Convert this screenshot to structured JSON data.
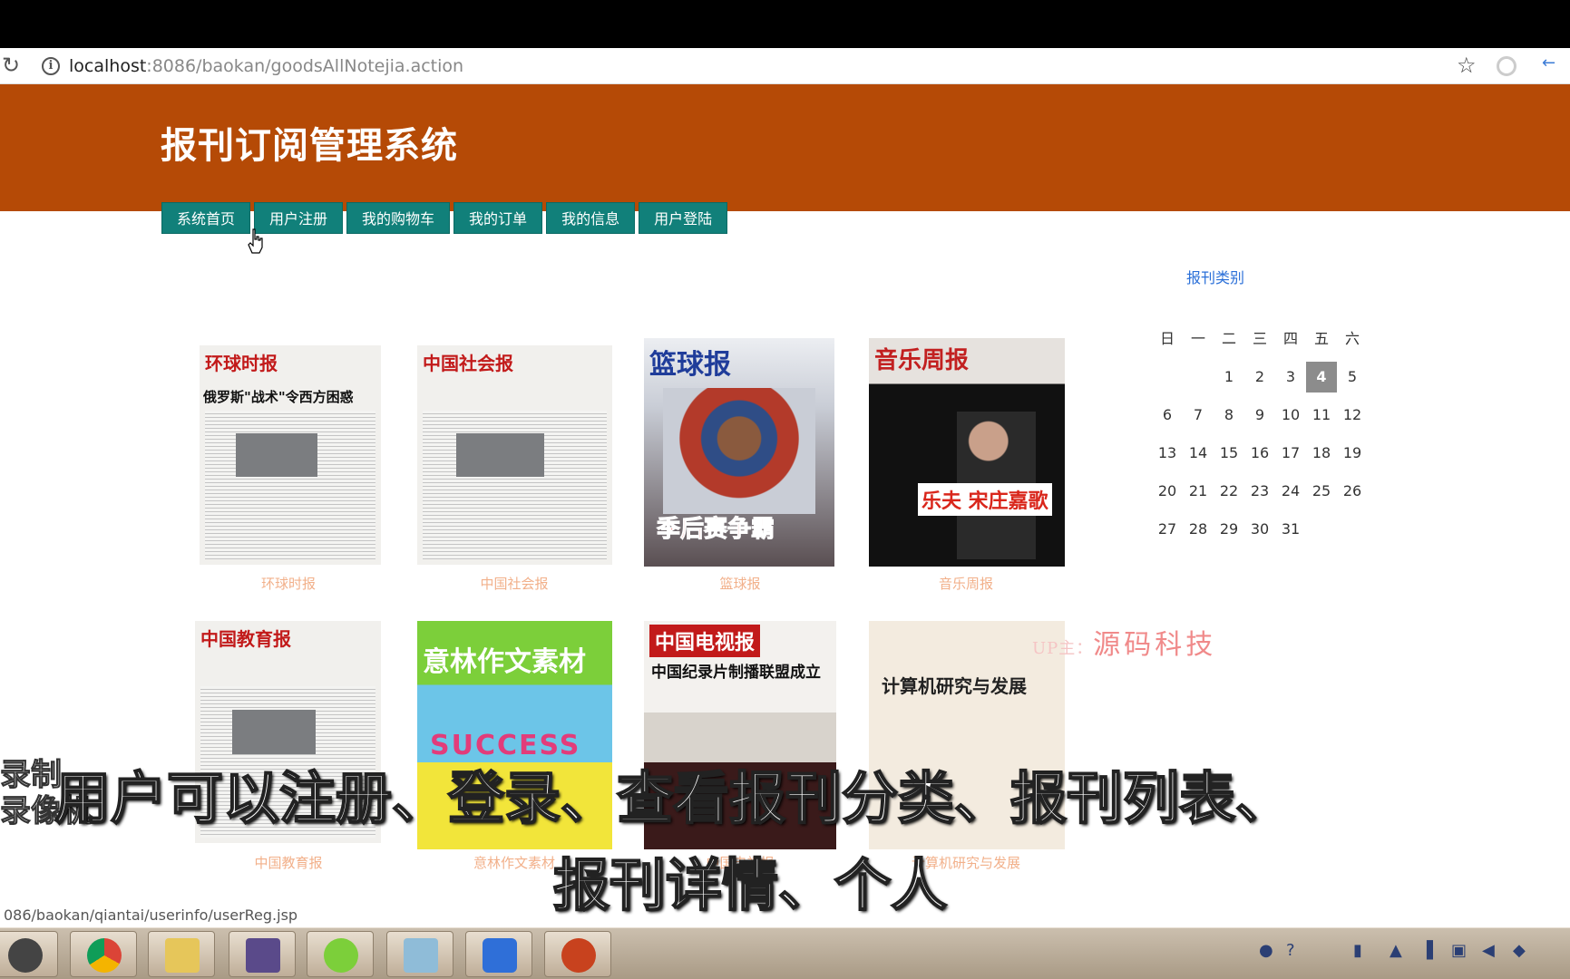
{
  "browser": {
    "url_host": "localhost",
    "url_rest": ":8086/baokan/goodsAllNotejia.action"
  },
  "site": {
    "title": "报刊订阅管理系统"
  },
  "nav": [
    "系统首页",
    "用户注册",
    "我的购物车",
    "我的订单",
    "我的信息",
    "用户登陆"
  ],
  "sidebar": {
    "category_link": "报刊类别"
  },
  "papers": [
    {
      "name": "环球时报",
      "masthead": "环球时报",
      "headline": "俄罗斯\"战术\"令西方困惑",
      "theme": "news"
    },
    {
      "name": "中国社会报",
      "masthead": "中国社会报",
      "headline": "",
      "theme": "news"
    },
    {
      "name": "篮球报",
      "masthead": "篮球报",
      "headline": "季后赛争霸",
      "theme": "sports"
    },
    {
      "name": "音乐周报",
      "masthead": "音乐周报",
      "headline": "乐夫 宋庄嘉歌",
      "theme": "music"
    },
    {
      "name": "中国教育报",
      "masthead": "中国教育报",
      "headline": "",
      "theme": "news"
    },
    {
      "name": "意林作文素材",
      "masthead": "意林作文素材",
      "headline": "SUCCESS",
      "theme": "green"
    },
    {
      "name": "中国电视报",
      "masthead": "中国电视报",
      "headline": "中国纪录片制播联盟成立",
      "theme": "tv"
    },
    {
      "name": "计算机研究与发展",
      "masthead": "计算机研究与发展",
      "headline": "",
      "theme": "journal"
    }
  ],
  "calendar": {
    "weekdays": [
      "日",
      "一",
      "二",
      "三",
      "四",
      "五",
      "六"
    ],
    "weeks": [
      [
        "",
        "",
        "1",
        "2",
        "3",
        "4",
        "5"
      ],
      [
        "6",
        "7",
        "8",
        "9",
        "10",
        "11",
        "12"
      ],
      [
        "13",
        "14",
        "15",
        "16",
        "17",
        "18",
        "19"
      ],
      [
        "20",
        "21",
        "22",
        "23",
        "24",
        "25",
        "26"
      ],
      [
        "27",
        "28",
        "29",
        "30",
        "31",
        "",
        ""
      ]
    ],
    "today": "4"
  },
  "watermark": {
    "prefix": "UP主：",
    "text": "源码科技"
  },
  "status_bar": {
    "url": "086/baokan/qiantai/userinfo/userReg.jsp"
  },
  "subtitles": {
    "line1": "用户可以注册、登录、查看报刊分类、报刊列表、",
    "line2": "报刊详情、个人"
  },
  "left_overlay": {
    "line1": "录制",
    "line2": "录像机"
  },
  "colors": {
    "header": "#b54a06",
    "nav": "#11807a",
    "label": "#f2b08a",
    "link": "#2a6fd8"
  }
}
